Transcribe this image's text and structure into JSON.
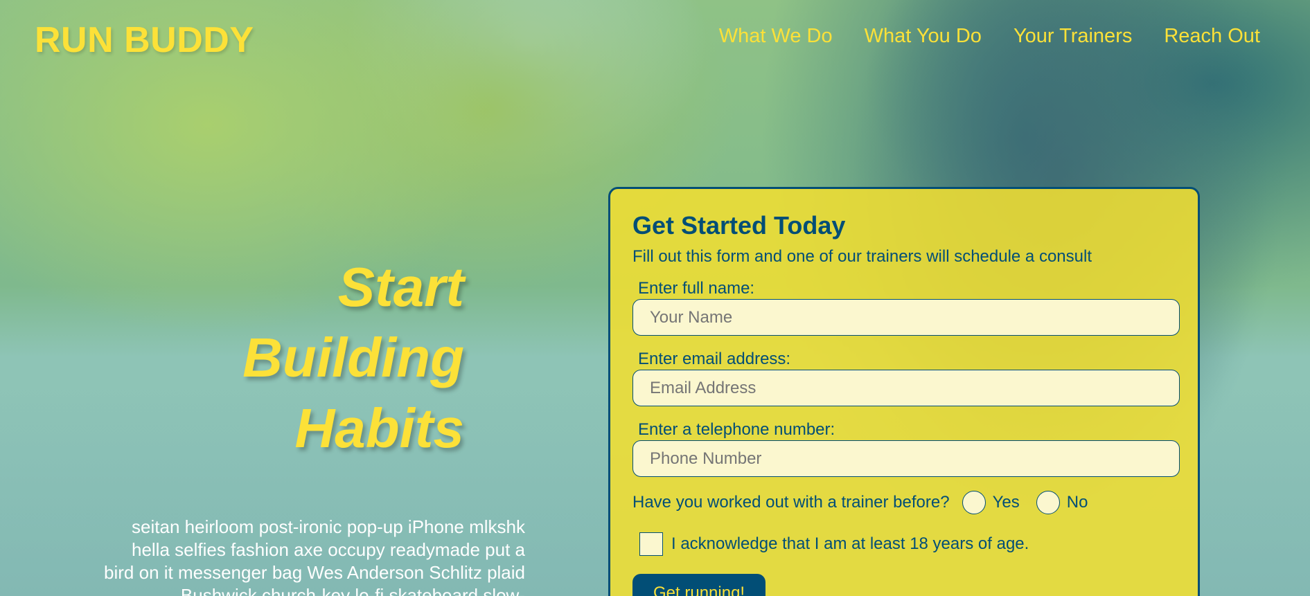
{
  "header": {
    "logo": "RUN BUDDY",
    "nav": [
      "What We Do",
      "What You Do",
      "Your Trainers",
      "Reach Out"
    ]
  },
  "hero": {
    "title_lines": [
      "Start",
      "Building",
      "Habits"
    ],
    "copy": "seitan heirloom post-ironic pop-up iPhone mlkshk hella selfies fashion axe occupy readymade put a bird on it messenger bag Wes Anderson Schlitz plaid Bushwick church-key lo-fi skateboard slow-"
  },
  "form": {
    "title": "Get Started Today",
    "subtitle": "Fill out this form and one of our trainers will schedule a consult",
    "name_label": "Enter full name:",
    "name_placeholder": "Your Name",
    "email_label": "Enter email address:",
    "email_placeholder": "Email Address",
    "phone_label": "Enter a telephone number:",
    "phone_placeholder": "Phone Number",
    "trainer_question": "Have you worked out with a trainer before?",
    "yes_label": "Yes",
    "no_label": "No",
    "age_ack": "I acknowledge that I am at least 18 years of age.",
    "submit_label": "Get running!"
  },
  "colors": {
    "accent_yellow": "#fce138",
    "primary_blue": "#024e76"
  }
}
